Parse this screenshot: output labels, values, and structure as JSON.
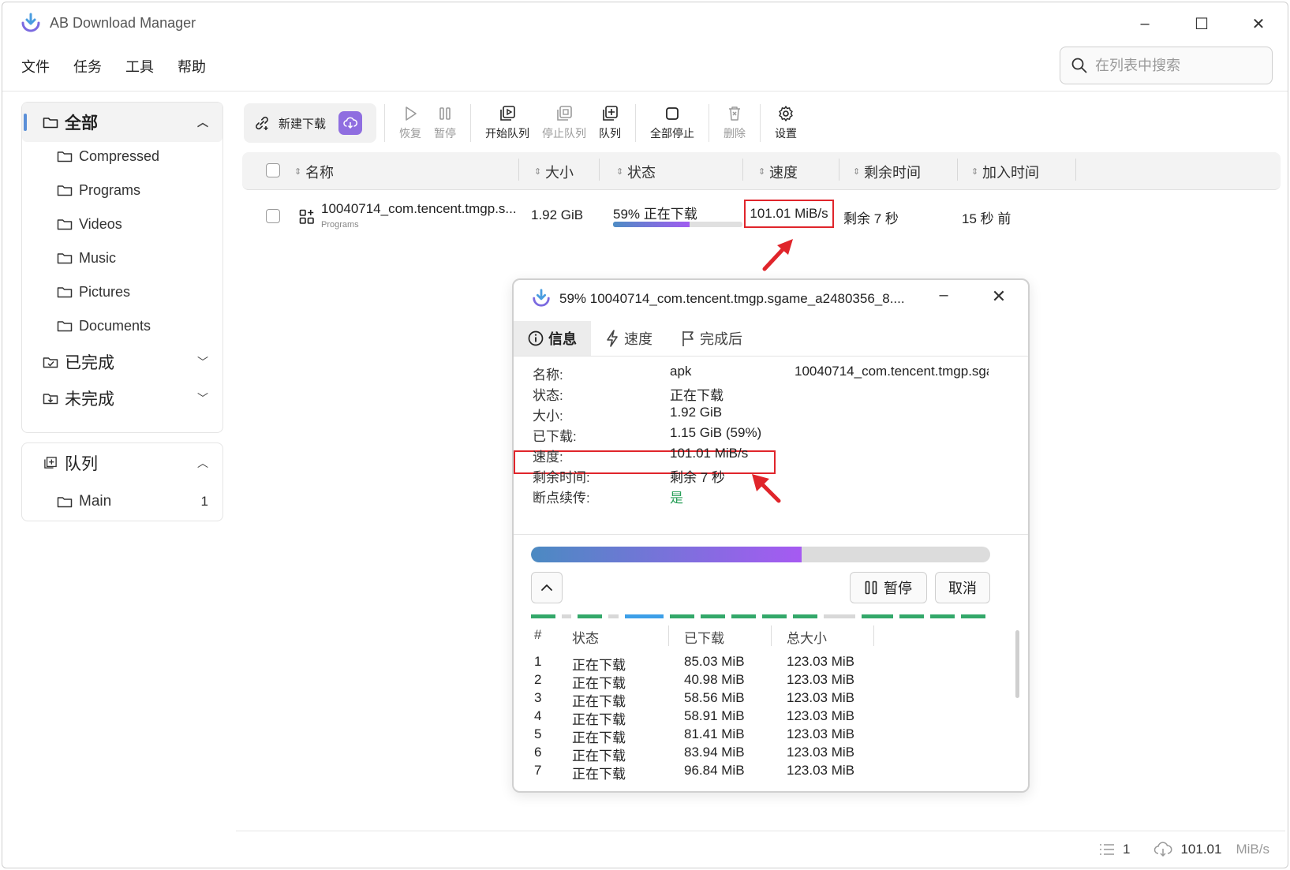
{
  "window": {
    "title": "AB Download Manager",
    "controls": {
      "minimize": "–",
      "maximize": "☐",
      "close": "✕"
    }
  },
  "menu": [
    "文件",
    "任务",
    "工具",
    "帮助"
  ],
  "search": {
    "placeholder": "在列表中搜索"
  },
  "sidebar": {
    "categories_header": "全部",
    "categories": [
      "Compressed",
      "Programs",
      "Videos",
      "Music",
      "Pictures",
      "Documents"
    ],
    "finished": "已完成",
    "unfinished": "未完成",
    "queue_header": "队列",
    "queues": [
      {
        "name": "Main",
        "count": "1"
      }
    ]
  },
  "toolbar": {
    "new_download": "新建下载",
    "resume": "恢复",
    "pause": "暂停",
    "start_queue": "开始队列",
    "stop_queue": "停止队列",
    "queue": "队列",
    "stop_all": "全部停止",
    "delete": "删除",
    "settings": "设置"
  },
  "table": {
    "columns": [
      "名称",
      "大小",
      "状态",
      "速度",
      "剩余时间",
      "加入时间"
    ],
    "rows": [
      {
        "name": "10040714_com.tencent.tmgp.s...",
        "category": "Programs",
        "size": "1.92 GiB",
        "status": "59% 正在下载",
        "progress": 0.59,
        "speed": "101.01 MiB/s",
        "remaining": "剩余 7 秒",
        "added": "15 秒 前"
      }
    ]
  },
  "statusbar": {
    "count": "1",
    "speed_value": "101.01",
    "speed_unit": "MiB/s"
  },
  "dialog": {
    "title": "59% 10040714_com.tencent.tmgp.sgame_a2480356_8....",
    "tabs": [
      "信息",
      "速度",
      "完成后"
    ],
    "info": [
      {
        "label": "名称:",
        "value": "apk",
        "value2": "10040714_com.tencent.tmgp.sga"
      },
      {
        "label": "状态:",
        "value": "正在下载"
      },
      {
        "label": "大小:",
        "value": "1.92 GiB"
      },
      {
        "label": "已下载:",
        "value": "1.15 GiB (59%)"
      },
      {
        "label": "速度:",
        "value": "101.01 MiB/s"
      },
      {
        "label": "剩余时间:",
        "value": "剩余 7 秒"
      },
      {
        "label": "断点续传:",
        "value": "是"
      }
    ],
    "progress": 0.59,
    "pause_label": "暂停",
    "cancel_label": "取消",
    "parts_columns": [
      "#",
      "状态",
      "已下载",
      "总大小"
    ],
    "parts": [
      {
        "n": "1",
        "status": "正在下载",
        "downloaded": "85.03 MiB",
        "total": "123.03 MiB"
      },
      {
        "n": "2",
        "status": "正在下载",
        "downloaded": "40.98 MiB",
        "total": "123.03 MiB"
      },
      {
        "n": "3",
        "status": "正在下载",
        "downloaded": "58.56 MiB",
        "total": "123.03 MiB"
      },
      {
        "n": "4",
        "status": "正在下载",
        "downloaded": "58.91 MiB",
        "total": "123.03 MiB"
      },
      {
        "n": "5",
        "status": "正在下载",
        "downloaded": "81.41 MiB",
        "total": "123.03 MiB"
      },
      {
        "n": "6",
        "status": "正在下载",
        "downloaded": "83.94 MiB",
        "total": "123.03 MiB"
      },
      {
        "n": "7",
        "status": "正在下载",
        "downloaded": "96.84 MiB",
        "total": "123.03 MiB"
      }
    ]
  },
  "colors": {
    "accent": "#8f6ee0",
    "highlight": "#e0252b",
    "progress_start": "#4b8ac2",
    "progress_end": "#a65af2",
    "part_done": "#33a86a",
    "resume_yes": "#2aa05a"
  }
}
